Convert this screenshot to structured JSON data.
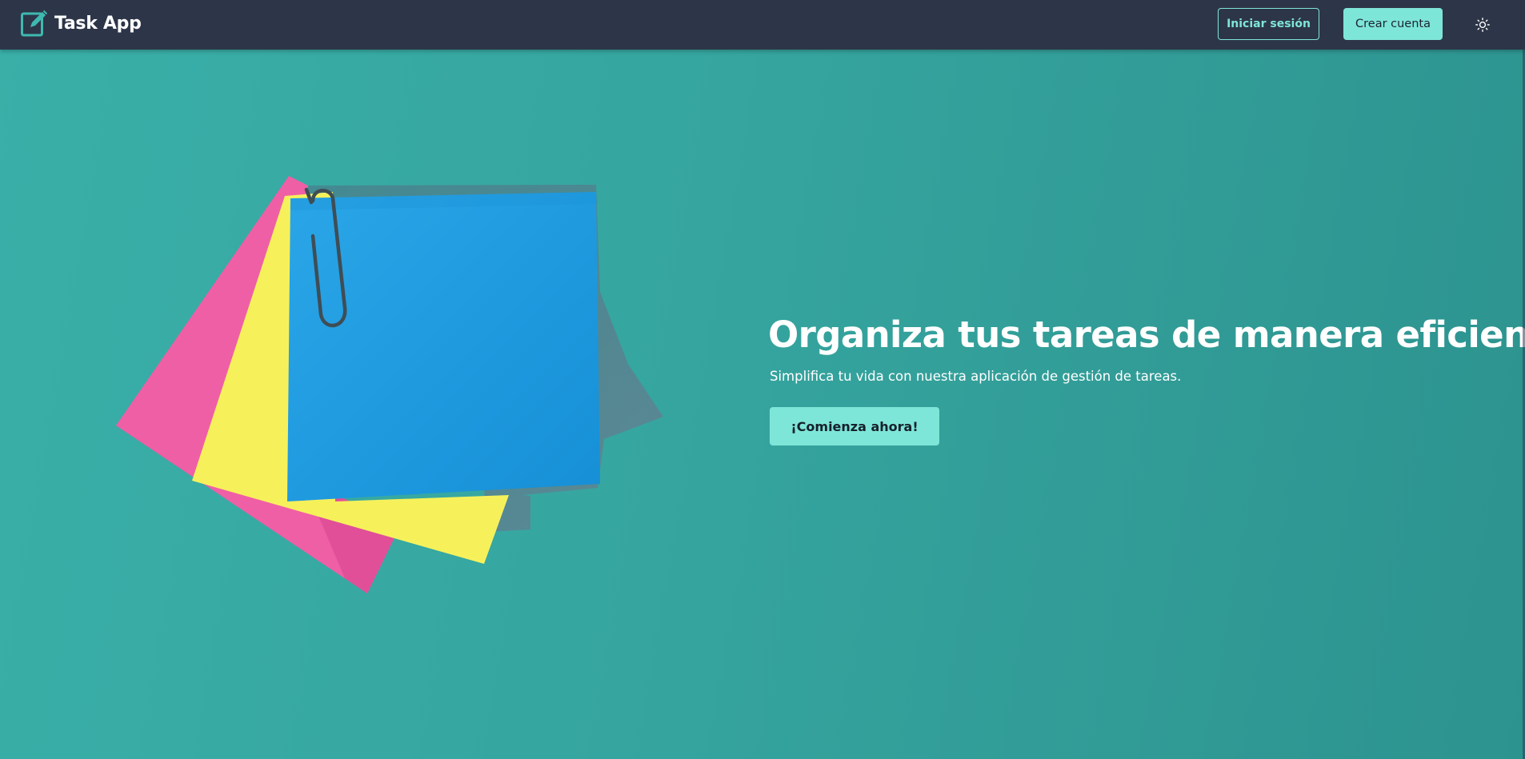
{
  "navbar": {
    "brand_name": "Task App",
    "brand_icon": "edit-note-icon",
    "login_label": "Iniciar sesión",
    "signup_label": "Crear cuenta",
    "theme_icon": "sun-icon"
  },
  "hero": {
    "title": "Organiza tus tareas de manera eficiente",
    "subtitle": "Simplifica tu vida con nuestra aplicación de gestión de tareas.",
    "cta_label": "¡Comienza ahora!",
    "illustration": "sticky-notes-with-paperclip"
  },
  "colors": {
    "navbar_bg": "#2d3648",
    "background": "#36a59f",
    "accent": "#7ee6d8",
    "note_pink": "#f062a8",
    "note_yellow": "#f7f25a",
    "note_blue": "#1f9be0"
  }
}
